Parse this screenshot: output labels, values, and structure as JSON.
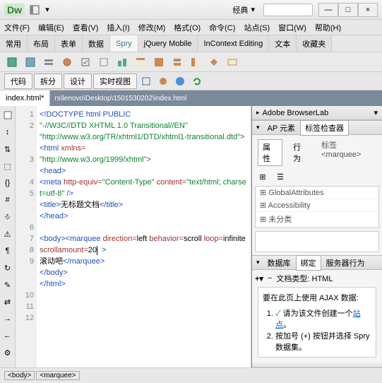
{
  "workspace_label": "经典",
  "menus": [
    "文件(F)",
    "编辑(E)",
    "查看(V)",
    "插入(I)",
    "修改(M)",
    "格式(O)",
    "命令(C)",
    "站点(S)",
    "窗口(W)",
    "帮助(H)"
  ],
  "insert_tabs": [
    "常用",
    "布局",
    "表单",
    "数据",
    "Spry",
    "jQuery Mobile",
    "InContext Editing",
    "文本",
    "收藏夹"
  ],
  "active_insert_tab": "Spry",
  "view_buttons": [
    "代码",
    "拆分",
    "设计",
    "实时视图"
  ],
  "doc_tab_label": "index.html*",
  "doc_path": "rs\\lenovo\\Desktop\\1501530202\\index.html",
  "gutter_lines": [
    "1",
    "2",
    "3",
    "4",
    "5",
    "6",
    "7",
    "8",
    "9",
    "10",
    "11",
    "12"
  ],
  "code_lines": [
    {
      "html": "<span class='kw'>&lt;!DOCTYPE html PUBLIC</span>"
    },
    {
      "html": "<span class='str'>\"-//W3C//DTD XHTML 1.0 Transitional//EN\"</span>"
    },
    {
      "html": "<span class='str'>\"http://www.w3.org/TR/xhtml1/DTD/xhtml1-transitional.dtd\"</span><span class='kw'>&gt;</span>"
    },
    {
      "html": "<span class='tag'>&lt;html</span> <span class='attr'>xmlns=</span>"
    },
    {
      "html": "<span class='str'>\"http://www.w3.org/1999/xhtml\"</span><span class='tag'>&gt;</span>"
    },
    {
      "html": "<span class='tag'>&lt;head&gt;</span>"
    },
    {
      "html": "<span class='tag'>&lt;meta</span> <span class='attr'>http-equiv=</span><span class='str'>\"Content-Type\"</span> <span class='attr'>content=</span><span class='str'>\"text/html; charset=utf-8\"</span> <span class='tag'>/&gt;</span>"
    },
    {
      "html": "<span class='tag'>&lt;title&gt;</span>无标题文档<span class='tag'>&lt;/title&gt;</span>"
    },
    {
      "html": "<span class='tag'>&lt;/head&gt;</span>"
    },
    {
      "html": "&nbsp;"
    },
    {
      "html": "<span class='tag'>&lt;body&gt;&lt;marquee</span> <span class='attr'>direction=</span>left <span class='attr'>behavior=</span>scroll <span class='attr'>loop=</span>infinite <span class='attr'>scrollamount=</span>20<span class='cursor'></span>  <span class='tag'>&gt;</span>"
    },
    {
      "html": "滚动吧<span class='tag'>&lt;/marquee&gt;</span>"
    },
    {
      "html": "<span class='tag'>&lt;/body&gt;</span>"
    },
    {
      "html": "<span class='tag'>&lt;/html&gt;</span>"
    }
  ],
  "panels": {
    "browserlab": "Adobe BrowserLab",
    "ap_elements_tab": "AP 元素",
    "tag_inspector_tab": "标签检查器",
    "attr_sub_tabs": [
      "属性",
      "行为"
    ],
    "tag_label": "标签 <marquee>",
    "attr_rows": [
      "GlobalAttributes",
      "Accessibility",
      "未分类"
    ],
    "db_tab": "数据库",
    "binding_tab": "绑定",
    "server_tab": "服务器行为",
    "doc_type_label": "文档类型: HTML",
    "ajax_heading": "要在此页上使用 AJAX 数据:",
    "ajax_step1_pre": "请为该文件创建一个",
    "ajax_step1_link": "站点",
    "ajax_step1_post": "。",
    "ajax_step2": "按加号 (+) 按钮并选择 Spry 数据集。"
  },
  "status_tags": [
    "<body>",
    "<marquee>"
  ]
}
